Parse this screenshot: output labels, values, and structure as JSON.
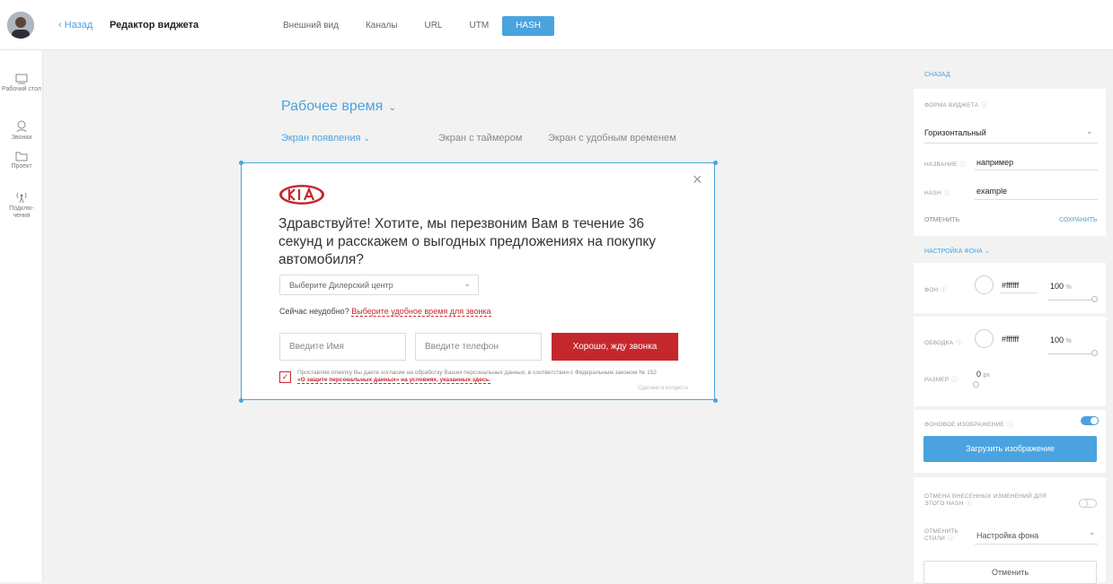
{
  "header": {
    "back_label": "Назад",
    "title": "Редактор виджета",
    "tabs": [
      {
        "label": "Внешний вид",
        "active": false
      },
      {
        "label": "Каналы",
        "active": false
      },
      {
        "label": "URL",
        "active": false
      },
      {
        "label": "UTM",
        "active": false
      },
      {
        "label": "HASH",
        "active": true
      }
    ],
    "accent": "#4aa3df"
  },
  "sidebar": {
    "items": [
      {
        "label": "Рабочий стол",
        "icon": "desktop-icon"
      },
      {
        "label": "Звонки",
        "icon": "user-phone-icon"
      },
      {
        "label": "Проект",
        "icon": "folder-icon"
      },
      {
        "label": "Подклю-чения",
        "icon": "antenna-icon"
      }
    ]
  },
  "canvas": {
    "work_time": "Рабочее время",
    "screens": [
      "Экран появления",
      "Экран с таймером",
      "Экран с удобным временем"
    ]
  },
  "widget": {
    "brand_color": "#c4282d",
    "headline": "Здравствуйте! Хотите, мы перезвоним Вам в течение 36 секунд и расскажем о выгодных предложениях на покупку автомобиля?",
    "dealer_placeholder": "Выберите Дилерский центр",
    "inconvenient_prefix": "Сейчас неудобно?",
    "inconvenient_link": "Выберите удобное время для звонка",
    "name_placeholder": "Введите Имя",
    "phone_placeholder": "Введите телефон",
    "call_button": "Хорошо, жду звонка",
    "consent_text": "Проставляя отметку Вы даете согласие на обработку Ваших персональных данных, в соответствии с Федеральным законом № 152",
    "consent_link": "«О защите персональных данных» на условиях, указанных здесь.",
    "made_in": "Сделано в konget.ru"
  },
  "panel": {
    "back_label": "СНАЗАД",
    "form_label": "ФОРМА ВИДЖЕТА",
    "form_value": "Горизонтальный",
    "name_label": "НАЗВАНИЕ",
    "name_value": "например",
    "hash_label": "HASH",
    "hash_value": "example",
    "cancel_label": "ОТМЕНИТЬ",
    "save_label": "СОХРАНИТЬ",
    "bg_settings_label": "НАСТРОЙКА ФОНА",
    "bg_label": "ФОН",
    "bg_color": "#ffffff",
    "bg_opacity": "100",
    "border_label": "ОБВОДКА",
    "border_color": "#ffffff",
    "border_opacity": "100",
    "percent_unit": "%",
    "size_label": "РАЗМЕР",
    "size_value": "0",
    "size_unit": "px",
    "bg_image_label": "ФОНОВОЕ ИЗОБРАЖЕНИЕ",
    "bg_image_enabled": true,
    "upload_button": "Загрузить изображение",
    "revert_label": "ОТМЕНА ВНЕСЕННЫХ ИЗМЕНЕНИЙ ДЛЯ ЭТОГО HASH",
    "revert_enabled": false,
    "revert_styles_label": "ОТМЕНИТЬ СТИЛИ",
    "revert_styles_value": "Настройка фона",
    "revert_button": "Отменить"
  }
}
